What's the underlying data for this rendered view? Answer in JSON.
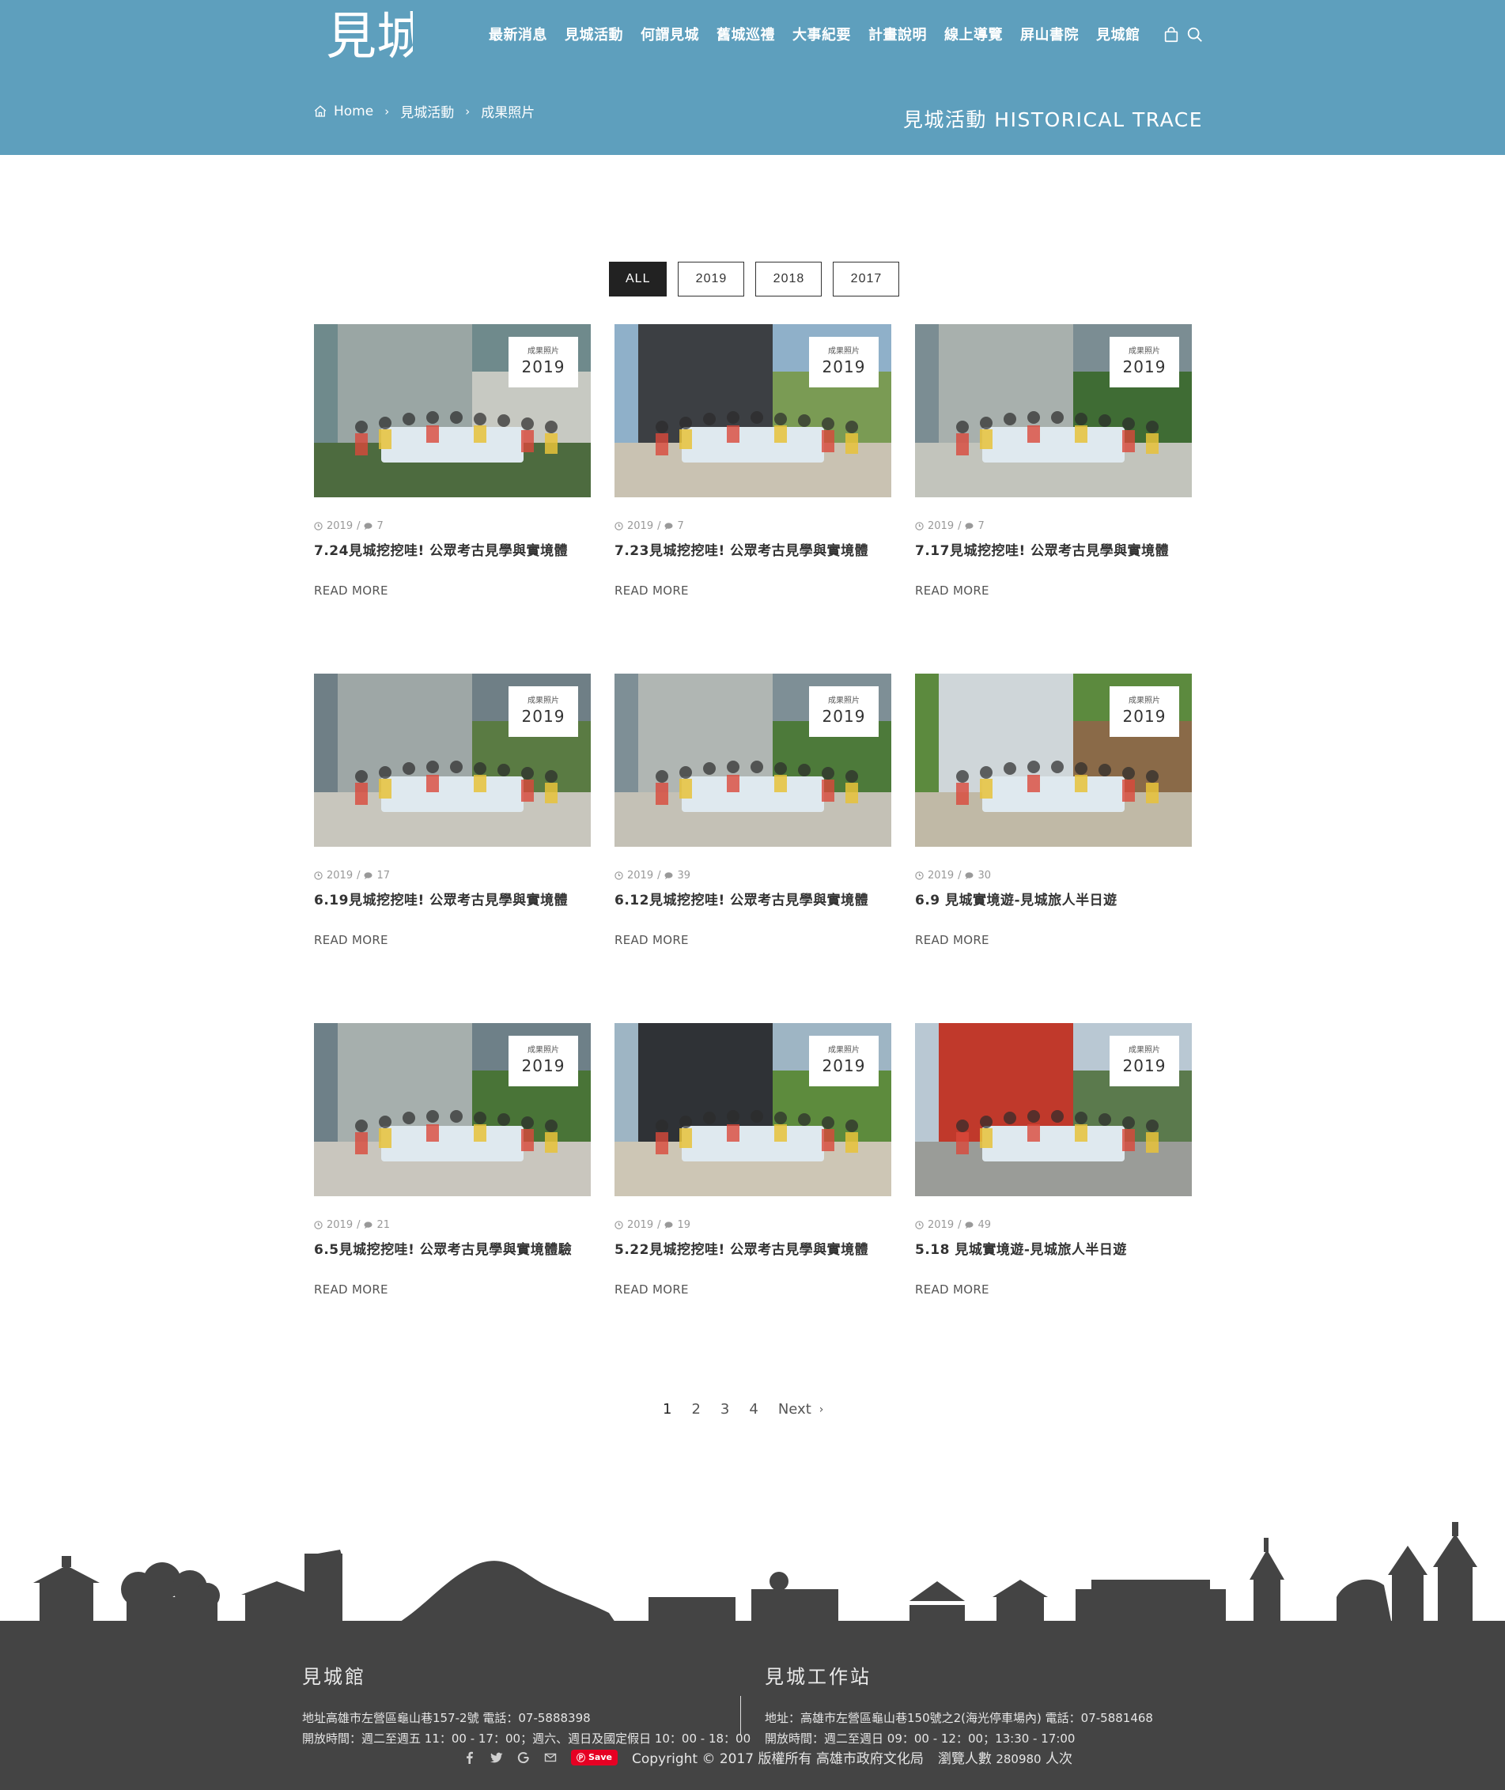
{
  "header": {
    "logo_text": "見城",
    "nav": [
      "最新消息",
      "見城活動",
      "何謂見城",
      "舊城巡禮",
      "大事紀要",
      "計畫說明",
      "線上導覽",
      "屏山書院",
      "見城館"
    ],
    "icons": [
      "shopping-bag-icon",
      "search-icon"
    ],
    "breadcrumb": [
      "Home",
      "見城活動",
      "成果照片"
    ],
    "page_heading": "見城活動 HISTORICAL TRACE",
    "bg_color": "#5e9fbd"
  },
  "filters": {
    "items": [
      "ALL",
      "2019",
      "2018",
      "2017"
    ],
    "active": "ALL"
  },
  "posts": [
    {
      "badge_tag": "成果照片",
      "badge_year": "2019",
      "year": "2019",
      "comments": "7",
      "title": "7.24見城挖挖哇! 公眾考古見學與實境體",
      "read_more": "READ MORE"
    },
    {
      "badge_tag": "成果照片",
      "badge_year": "2019",
      "year": "2019",
      "comments": "7",
      "title": "7.23見城挖挖哇! 公眾考古見學與實境體",
      "read_more": "READ MORE"
    },
    {
      "badge_tag": "成果照片",
      "badge_year": "2019",
      "year": "2019",
      "comments": "7",
      "title": "7.17見城挖挖哇! 公眾考古見學與實境體",
      "read_more": "READ MORE"
    },
    {
      "badge_tag": "成果照片",
      "badge_year": "2019",
      "year": "2019",
      "comments": "17",
      "title": "6.19見城挖挖哇! 公眾考古見學與實境體",
      "read_more": "READ MORE"
    },
    {
      "badge_tag": "成果照片",
      "badge_year": "2019",
      "year": "2019",
      "comments": "39",
      "title": "6.12見城挖挖哇! 公眾考古見學與實境體",
      "read_more": "READ MORE"
    },
    {
      "badge_tag": "成果照片",
      "badge_year": "2019",
      "year": "2019",
      "comments": "30",
      "title": "6.9 見城實境遊-見城旅人半日遊",
      "read_more": "READ MORE"
    },
    {
      "badge_tag": "成果照片",
      "badge_year": "2019",
      "year": "2019",
      "comments": "21",
      "title": "6.5見城挖挖哇! 公眾考古見學與實境體驗",
      "read_more": "READ MORE"
    },
    {
      "badge_tag": "成果照片",
      "badge_year": "2019",
      "year": "2019",
      "comments": "19",
      "title": "5.22見城挖挖哇! 公眾考古見學與實境體",
      "read_more": "READ MORE"
    },
    {
      "badge_tag": "成果照片",
      "badge_year": "2019",
      "year": "2019",
      "comments": "49",
      "title": "5.18 見城實境遊-見城旅人半日遊",
      "read_more": "READ MORE"
    }
  ],
  "pagination": {
    "pages": [
      "1",
      "2",
      "3",
      "4"
    ],
    "current": "1",
    "next_label": "Next"
  },
  "footer": {
    "museum": {
      "name": "見城館",
      "address": "地址高雄市左營區龜山巷157-2號 電話：07-5888398",
      "hours": "開放時間：週二至週五 11：00 - 17：00；週六、週日及國定假日 10：00 - 18：00"
    },
    "station": {
      "name": "見城工作站",
      "address": "地址：高雄市左營區龜山巷150號之2(海光停車場內) 電話：07-5881468",
      "hours": "開放時間：週二至週日 09：00 - 12：00；13:30 - 17:00"
    },
    "social_icons": [
      "facebook-icon",
      "twitter-icon",
      "google-icon",
      "mail-icon"
    ],
    "pin_save_label": "Save",
    "copyright": "Copyright © 2017 版權所有 高雄市政府文化局",
    "visit_label": "瀏覽人數",
    "visit_count": "280980",
    "visit_unit": "人次",
    "bg_color": "#444444"
  }
}
